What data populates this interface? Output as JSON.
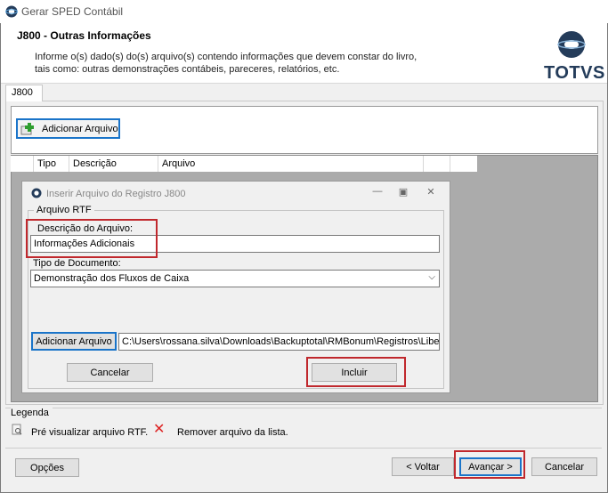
{
  "window": {
    "title": "Gerar SPED Contábil"
  },
  "header": {
    "title": "J800 - Outras Informações",
    "desc_line1": "Informe o(s) dado(s) do(s) arquivo(s) contendo informações que devem constar do livro,",
    "desc_line2": "tais como: outras demonstrações contábeis, pareceres, relatórios, etc.",
    "logo_text": "TOTVS"
  },
  "tabs": [
    {
      "label": "J800"
    }
  ],
  "toolbar": {
    "add_file_label": "Adicionar Arquivo"
  },
  "grid": {
    "columns": [
      "Tipo",
      "Descrição",
      "Arquivo"
    ]
  },
  "dialog": {
    "title": "Inserir Arquivo do Registro J800",
    "group_label": "Arquivo RTF",
    "description_label": "Descrição do Arquivo:",
    "description_value": "Informações Adicionais",
    "doc_type_label": "Tipo de Documento:",
    "doc_type_value": "Demonstração dos Fluxos de Caixa",
    "add_file_label": "Adicionar Arquivo",
    "file_path": "C:\\Users\\rossana.silva\\Downloads\\Backuptotal\\RMBonum\\Registros\\Libe",
    "cancel_label": "Cancelar",
    "include_label": "Incluir"
  },
  "legend": {
    "title": "Legenda",
    "preview_text": "Pré visualizar arquivo RTF.",
    "remove_text": "Remover arquivo da lista."
  },
  "footer": {
    "options_label": "Opções",
    "back_label": "< Voltar",
    "next_label": "Avançar >",
    "cancel_label": "Cancelar"
  },
  "colors": {
    "highlight": "#c0282d",
    "focus_blue": "#1a74c9",
    "brand": "#243c5a"
  }
}
